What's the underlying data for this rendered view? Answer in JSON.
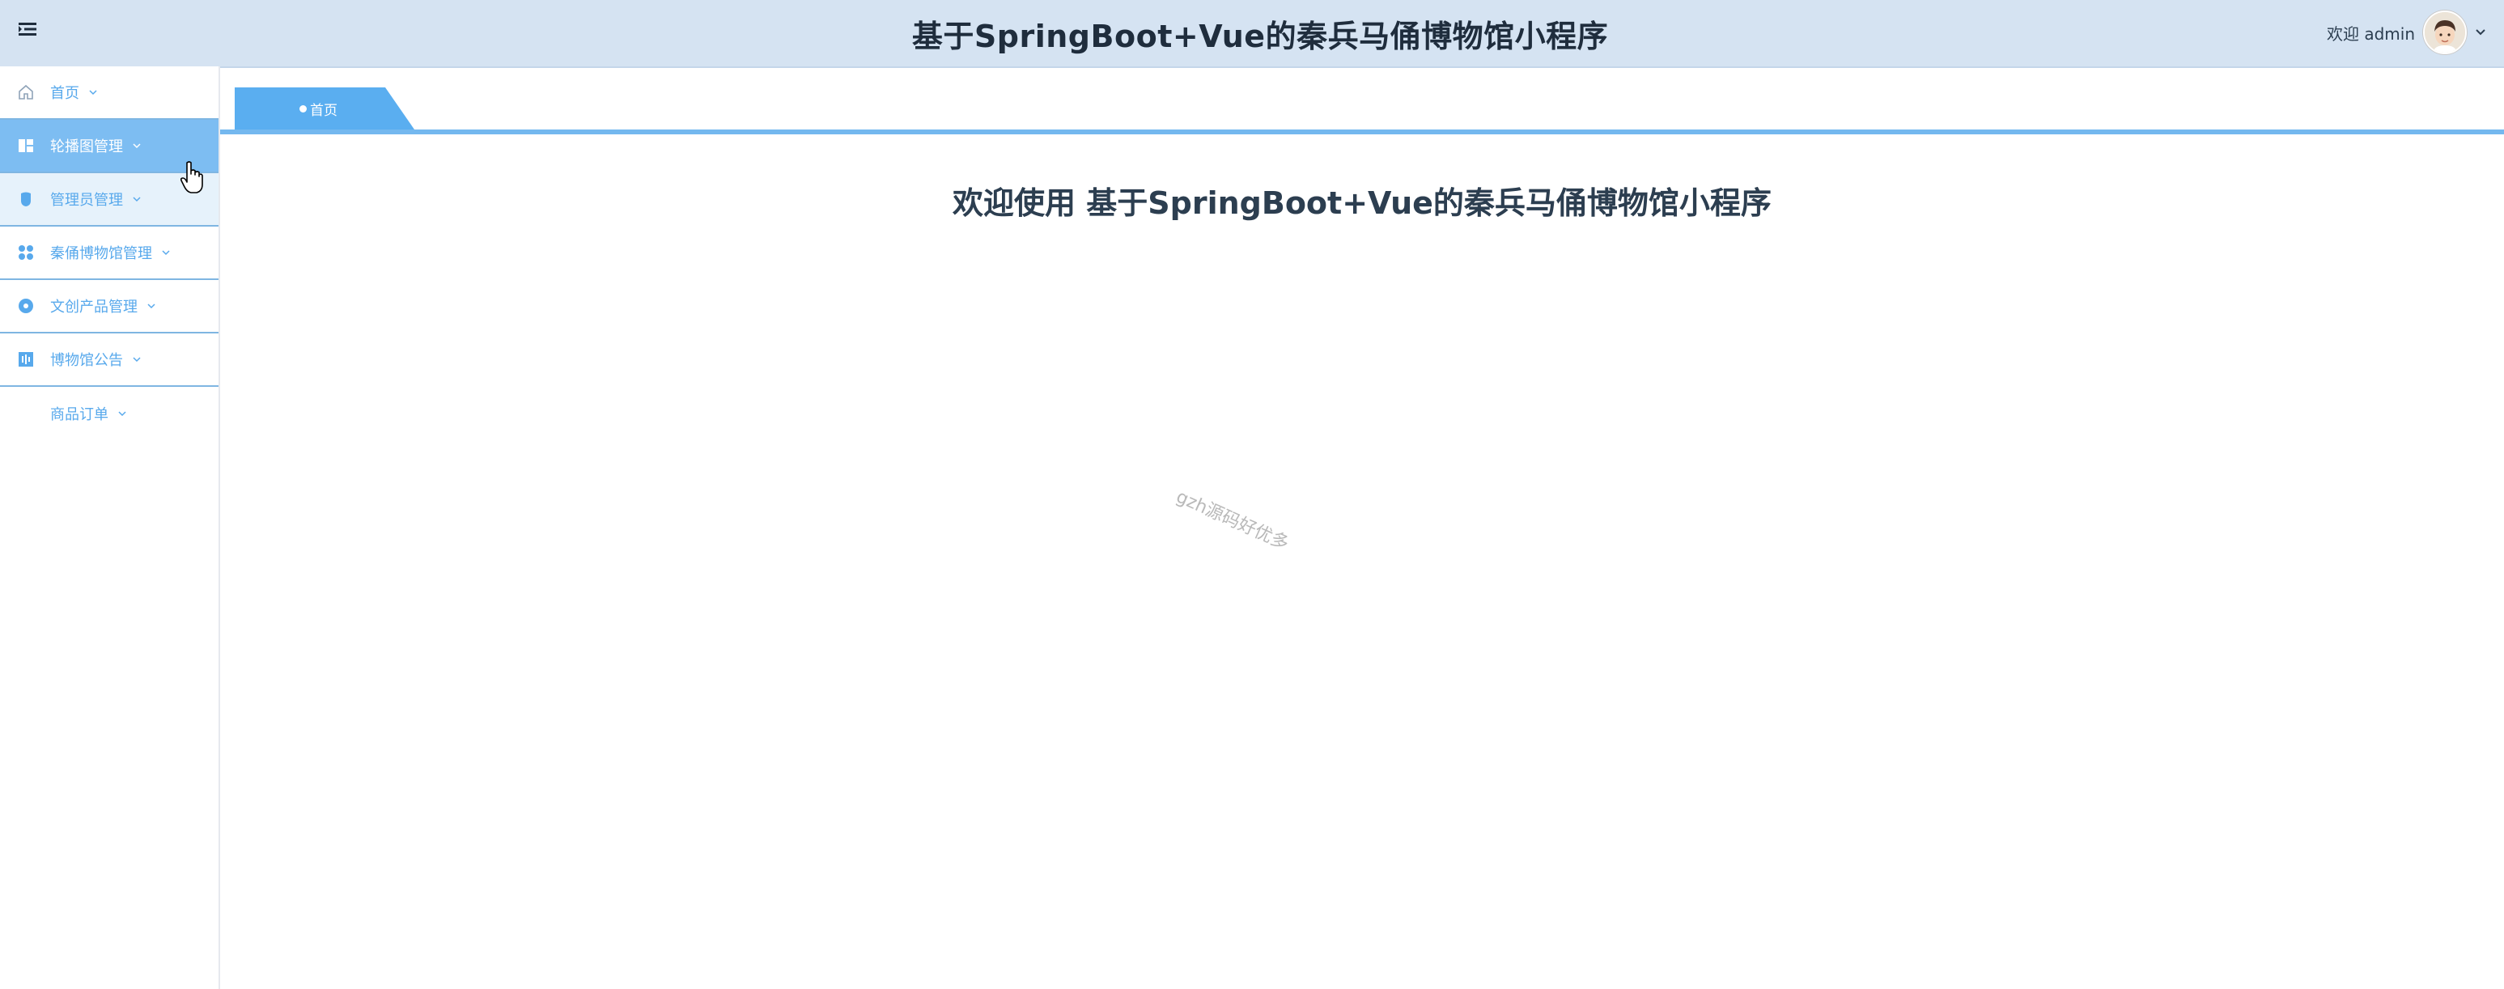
{
  "header": {
    "title": "基于SpringBoot+Vue的秦兵马俑博物馆小程序",
    "welcome": "欢迎 admin",
    "menu_icon": "menu-toggle-icon",
    "avatar_icon": "user-avatar",
    "colors": {
      "background": "#d5e3f2",
      "title": "#1f2d3d"
    }
  },
  "sidebar": {
    "items": [
      {
        "label": "首页",
        "icon": "home-icon",
        "state": "normal"
      },
      {
        "label": "轮播图管理",
        "icon": "carousel-icon",
        "state": "active"
      },
      {
        "label": "管理员管理",
        "icon": "admin-icon",
        "state": "hover"
      },
      {
        "label": "秦俑博物馆管理",
        "icon": "grid-apps-icon",
        "state": "normal"
      },
      {
        "label": "文创产品管理",
        "icon": "product-icon",
        "state": "normal"
      },
      {
        "label": "博物馆公告",
        "icon": "notice-icon",
        "state": "normal"
      },
      {
        "label": "商品订单",
        "icon": "",
        "state": "normal"
      }
    ],
    "colors": {
      "text": "#58a9ec",
      "active_bg": "#7dbdf2",
      "border": "#7fb6e2"
    }
  },
  "tabs": [
    {
      "label": "首页",
      "active": true
    }
  ],
  "main": {
    "welcome_heading": "欢迎使用 基于SpringBoot+Vue的秦兵马俑博物馆小程序"
  },
  "watermark": "gzh源码好优多"
}
